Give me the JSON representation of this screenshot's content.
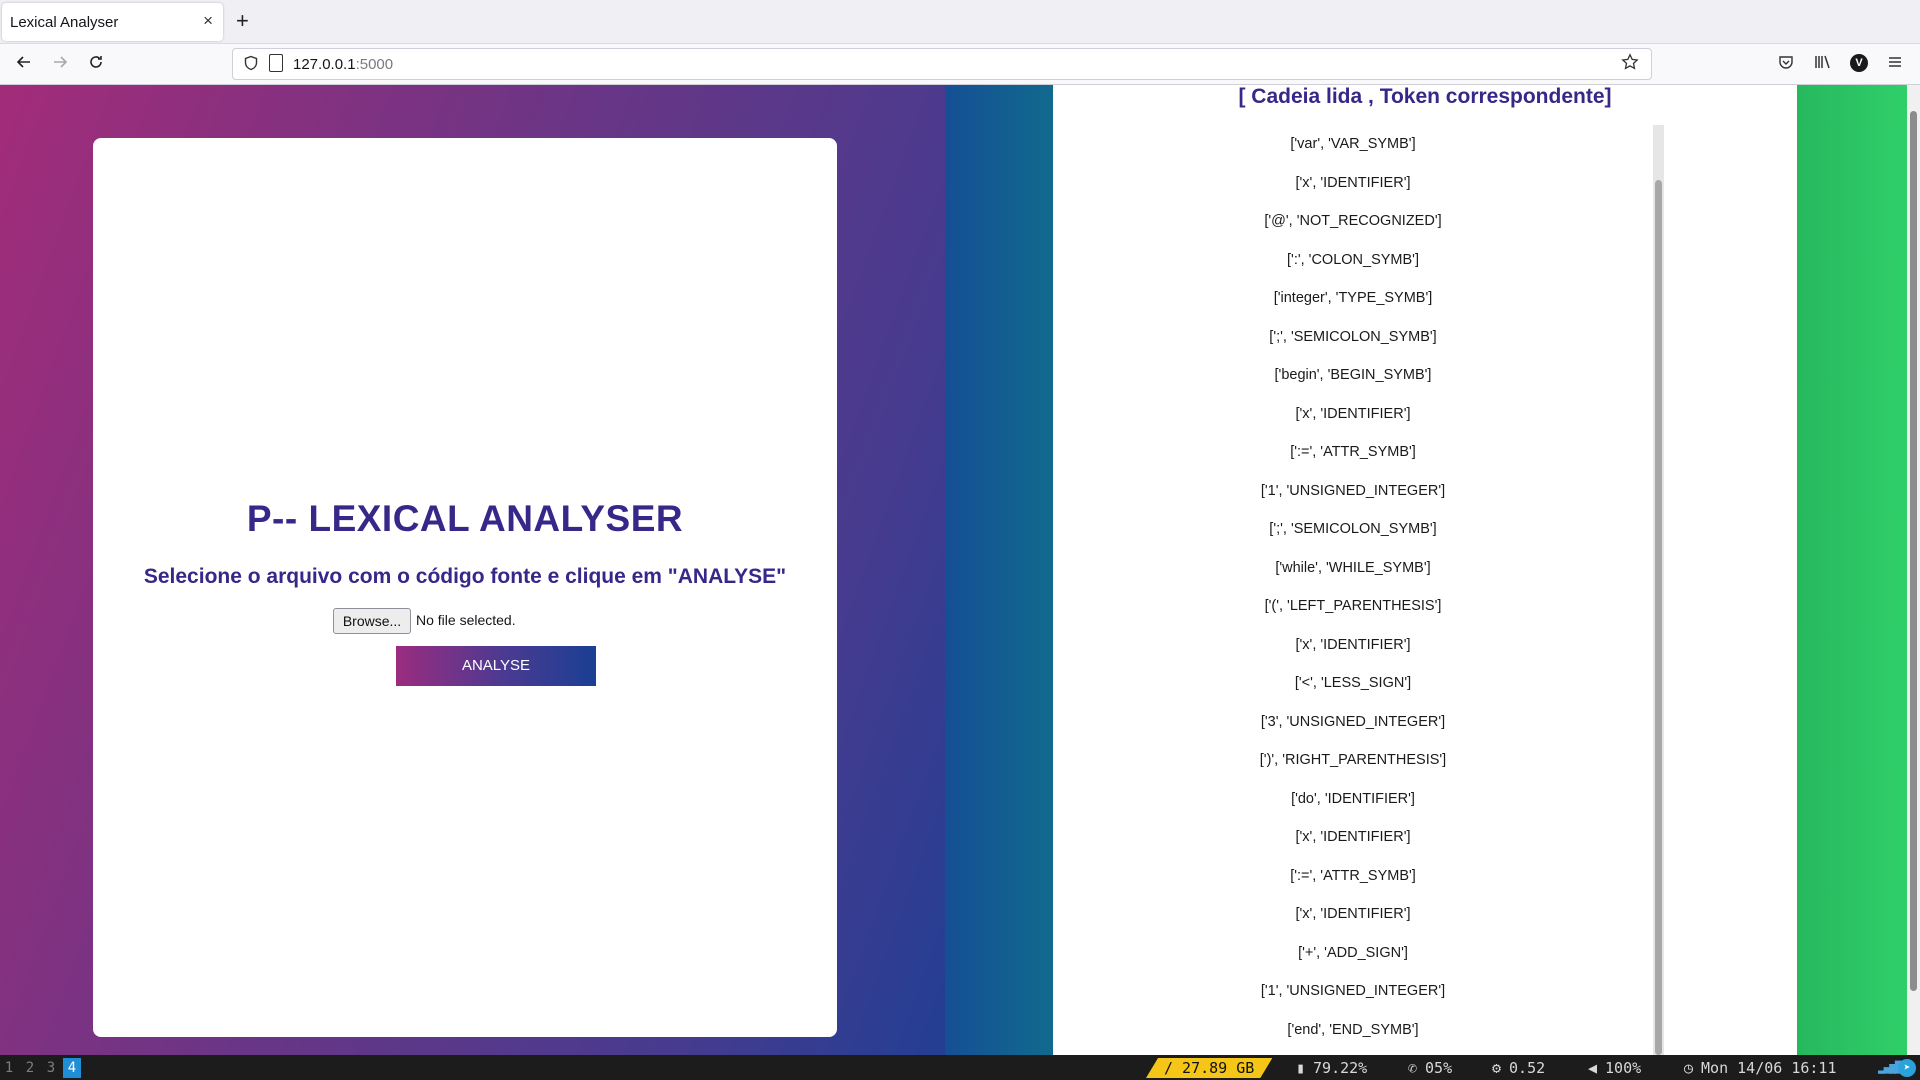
{
  "browser": {
    "tab_title": "Lexical Analyser",
    "tab_close": "×",
    "new_tab": "+",
    "url_host": "127.0.0.1",
    "url_port": ":5000",
    "back_icon": "arrow-left-icon",
    "forward_icon": "arrow-right-icon",
    "reload_icon": "reload-icon",
    "avatar_letter": "V"
  },
  "form": {
    "title": "P-- LEXICAL ANALYSER",
    "subtitle": "Selecione o arquivo com o código fonte e clique em \"ANALYSE\"",
    "browse_label": "Browse...",
    "file_status": "No file selected.",
    "submit_label": "ANALYSE"
  },
  "results": {
    "heading": "[ Cadeia lida , Token correspondente]",
    "tokens": [
      "['var', 'VAR_SYMB']",
      "['x', 'IDENTIFIER']",
      "['@', 'NOT_RECOGNIZED']",
      "[':', 'COLON_SYMB']",
      "['integer', 'TYPE_SYMB']",
      "[';', 'SEMICOLON_SYMB']",
      "['begin', 'BEGIN_SYMB']",
      "['x', 'IDENTIFIER']",
      "[':=', 'ATTR_SYMB']",
      "['1', 'UNSIGNED_INTEGER']",
      "[';', 'SEMICOLON_SYMB']",
      "['while', 'WHILE_SYMB']",
      "['(', 'LEFT_PARENTHESIS']",
      "['x', 'IDENTIFIER']",
      "['<', 'LESS_SIGN']",
      "['3', 'UNSIGNED_INTEGER']",
      "[')', 'RIGHT_PARENTHESIS']",
      "['do', 'IDENTIFIER']",
      "['x', 'IDENTIFIER']",
      "[':=', 'ATTR_SYMB']",
      "['x', 'IDENTIFIER']",
      "['+', 'ADD_SIGN']",
      "['1', 'UNSIGNED_INTEGER']",
      "['end', 'END_SYMB']"
    ]
  },
  "taskbar": {
    "workspaces": [
      "1",
      "2",
      "3",
      "4"
    ],
    "active_workspace": "4",
    "disk": "/ 27.89 GB",
    "memory": "79.22%",
    "cpu": "05%",
    "load": "0.52",
    "volume": "100%",
    "datetime": "Mon 14/06 16:11"
  },
  "colors": {
    "heading": "#362789",
    "gradient_start": "#a22c7a",
    "gradient_end": "#1a3f93",
    "green_strip": "#2fcf6a",
    "active_workspace": "#1e8fd6",
    "disk_segment": "#f5c518"
  }
}
